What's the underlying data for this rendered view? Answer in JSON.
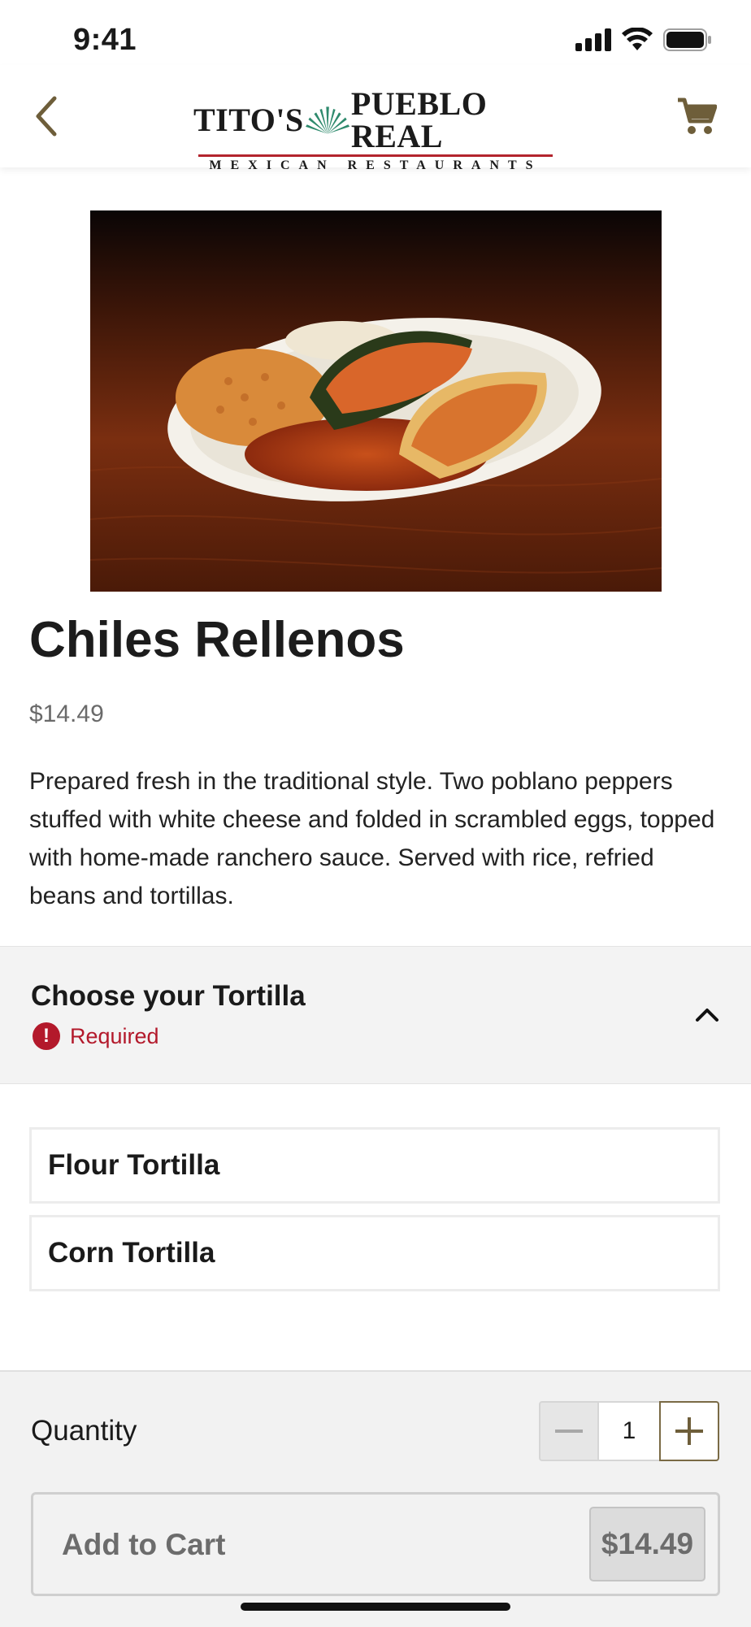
{
  "status_bar": {
    "time": "9:41"
  },
  "header": {
    "logo_line1_left": "TITO'S",
    "logo_line1_right": "PUEBLO REAL",
    "logo_line2": "MEXICAN RESTAURANTS",
    "back_icon": "chevron-left-icon",
    "cart_icon": "cart-icon",
    "accent_color": "#7a6a45"
  },
  "item": {
    "name": "Chiles Rellenos",
    "price": "$14.49",
    "description": "Prepared fresh in the traditional style. Two poblano peppers stuffed with white cheese and folded in scrambled eggs, topped with home-made ranchero sauce. Served with rice, refried beans and tortillas."
  },
  "modifier": {
    "title": "Choose your Tortilla",
    "required_label": "Required",
    "required_color": "#b3192b",
    "options": [
      {
        "label": "Flour Tortilla"
      },
      {
        "label": "Corn Tortilla"
      }
    ]
  },
  "footer": {
    "quantity_label": "Quantity",
    "quantity_value": "1",
    "add_to_cart_label": "Add to Cart",
    "add_to_cart_price": "$14.49"
  }
}
